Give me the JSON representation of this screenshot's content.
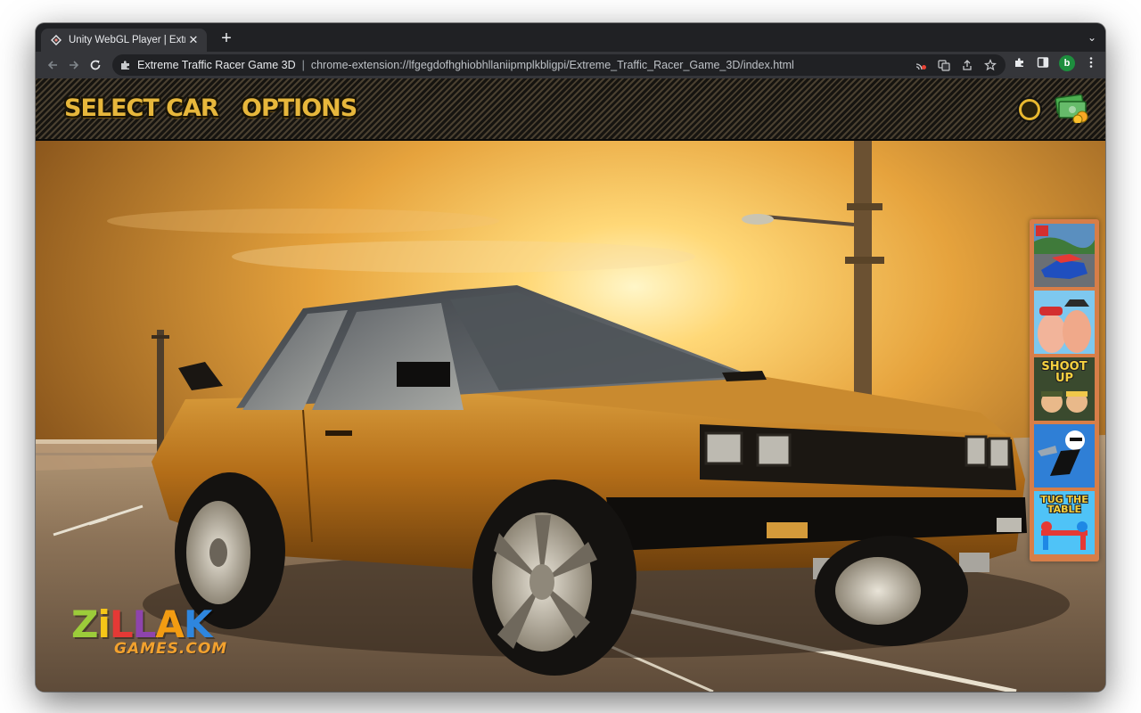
{
  "browser": {
    "tab_title": "Unity WebGL Player | Extreme",
    "tab_close": "✕",
    "new_tab": "+",
    "tab_search": "⌄",
    "site_name": "Extreme Traffic Racer Game 3D",
    "separator": "|",
    "url": "chrome-extension://lfgegdofhghiobhllaniipmplkbligpi/Extreme_Traffic_Racer_Game_3D/index.html",
    "profile_initial": "b"
  },
  "icons": {
    "back": "arrow-left-icon",
    "forward": "arrow-right-icon",
    "reload": "reload-icon",
    "extension": "puzzle-icon",
    "bookmark": "star-icon",
    "menu": "three-dots-icon"
  },
  "game": {
    "menu": {
      "select_car": "SELECT CAR",
      "options": "OPTIONS"
    },
    "side_ads": [
      {
        "name": "racing-game",
        "label": ""
      },
      {
        "name": "pirate-thumb-game",
        "label": ""
      },
      {
        "name": "shoot-up",
        "label": "SHOOT UP"
      },
      {
        "name": "stickman-jetpack",
        "label": ""
      },
      {
        "name": "tug-the-table",
        "label": "TUG THE TABLE"
      }
    ],
    "logo": {
      "letters": [
        "Z",
        "i",
        "L",
        "L",
        "A",
        "K"
      ],
      "subtitle": "GAMES.COM"
    }
  },
  "colors": {
    "hud_gold": "#e7b73c",
    "car_body": "#b8761c",
    "sky_sun": "#fff3b0",
    "ad_frame": "#d77e48"
  }
}
